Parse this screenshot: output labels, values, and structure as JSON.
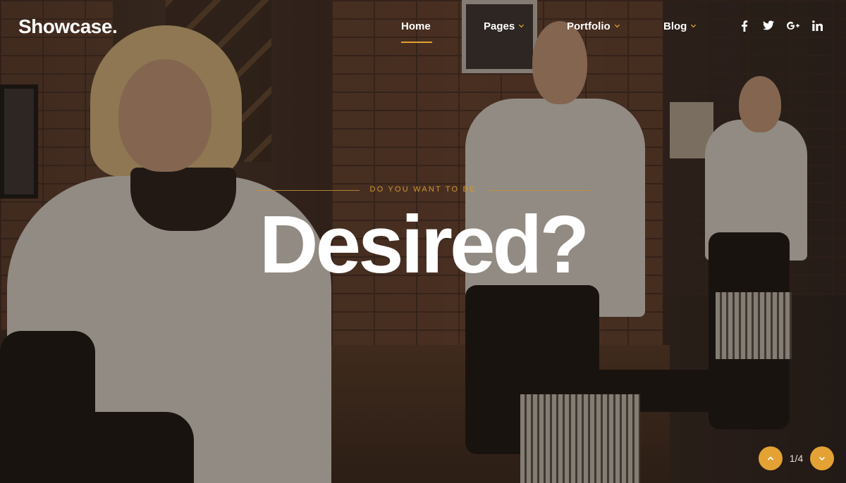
{
  "brand": {
    "logo_text": "Showcase."
  },
  "nav": {
    "items": [
      {
        "label": "Home",
        "has_dropdown": false,
        "active": true
      },
      {
        "label": "Pages",
        "has_dropdown": true,
        "active": false
      },
      {
        "label": "Portfolio",
        "has_dropdown": true,
        "active": false
      },
      {
        "label": "Blog",
        "has_dropdown": true,
        "active": false
      }
    ]
  },
  "social": [
    {
      "icon": "facebook-icon"
    },
    {
      "icon": "twitter-icon"
    },
    {
      "icon": "google-plus-icon"
    },
    {
      "icon": "linkedin-icon"
    }
  ],
  "hero": {
    "eyebrow": "DO YOU WANT TO BE",
    "headline": "Desired?"
  },
  "slider": {
    "counter": "1/4",
    "prev_icon": "chevron-up-icon",
    "next_icon": "chevron-down-icon"
  },
  "colors": {
    "accent": "#e3a233",
    "text": "#ffffff"
  }
}
